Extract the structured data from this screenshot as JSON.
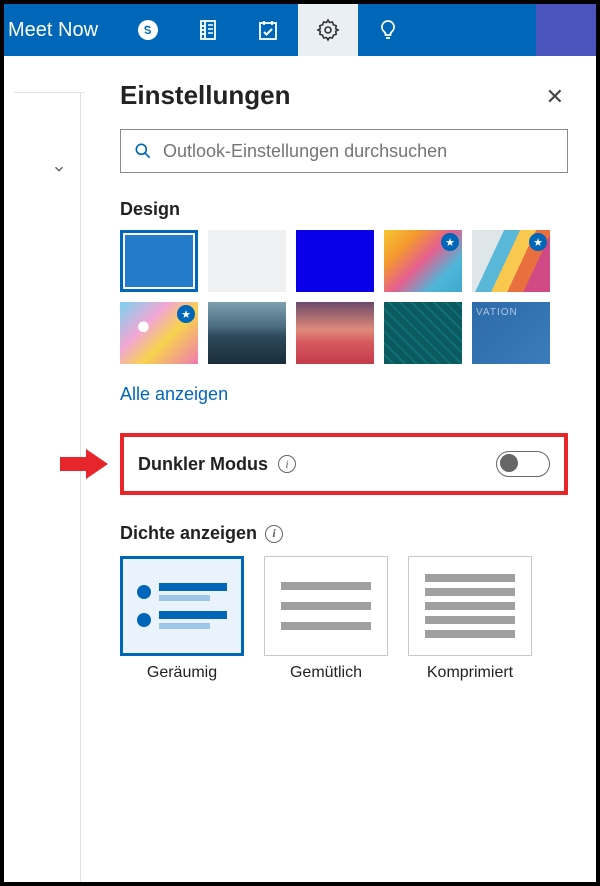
{
  "topbar": {
    "meet_now": "Meet Now"
  },
  "panel": {
    "title": "Einstellungen",
    "search_placeholder": "Outlook-Einstellungen durchsuchen"
  },
  "themes": {
    "label": "Design",
    "show_all": "Alle anzeigen"
  },
  "dark_mode": {
    "label": "Dunkler Modus",
    "enabled": false
  },
  "density": {
    "label": "Dichte anzeigen",
    "options": {
      "roomy": "Geräumig",
      "cozy": "Gemütlich",
      "compact": "Komprimiert"
    },
    "selected": "roomy"
  }
}
